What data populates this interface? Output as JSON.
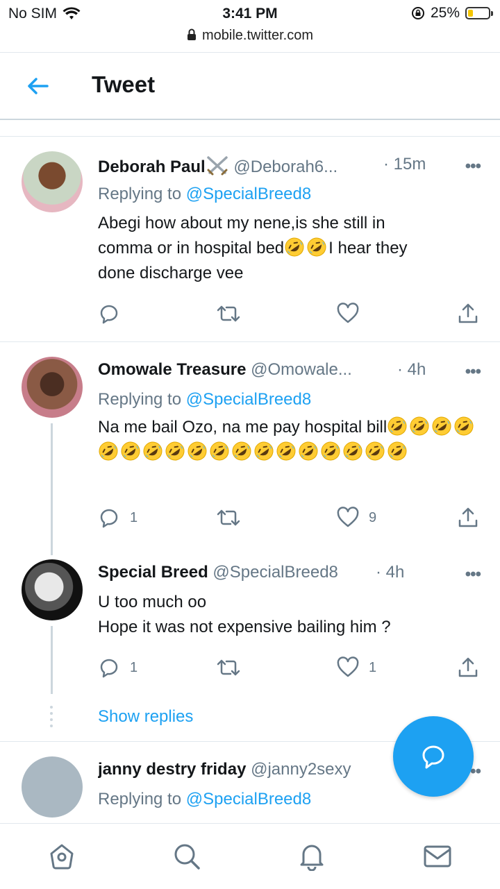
{
  "status_bar": {
    "carrier": "No SIM",
    "time": "3:41 PM",
    "battery_percent": "25%",
    "battery_level": 0.25,
    "url": "mobile.twitter.com"
  },
  "header": {
    "title": "Tweet"
  },
  "tweets": [
    {
      "name": "Deborah Paul",
      "handle": "@Deborah6...",
      "time": "· 15m",
      "replying_prefix": "Replying to ",
      "replying_to": "@SpecialBreed8",
      "text_lines": [
        "Abegi how about my nene,is she still in",
        "comma or in hospital bed",
        "I hear they",
        "done discharge vee"
      ],
      "reply_count": "",
      "like_count": ""
    },
    {
      "name": "Omowale Treasure",
      "handle": "@Omowale...",
      "time": "· 4h",
      "replying_prefix": "Replying to ",
      "replying_to": "@SpecialBreed8",
      "text_lines": [
        "Na me bail Ozo, na me pay hospital bill"
      ],
      "reply_count": "1",
      "like_count": "9"
    },
    {
      "name": "Special Breed",
      "handle": "@SpecialBreed8",
      "time": "· 4h",
      "text_lines": [
        "U too much oo",
        "Hope it was not expensive bailing him ?"
      ],
      "reply_count": "1",
      "like_count": "1"
    },
    {
      "name": "janny destry friday",
      "handle": "@janny2sexy",
      "replying_prefix": "Replying to ",
      "replying_to": "@SpecialBreed8"
    }
  ],
  "show_replies": "Show replies",
  "colors": {
    "accent": "#1da1f2",
    "muted": "#657786",
    "divider": "#e1e8ed"
  },
  "icons": {
    "emoji": "rolling-on-floor-laughing",
    "fab": "compose-reply",
    "nav": [
      "home",
      "search",
      "notifications",
      "messages"
    ]
  }
}
